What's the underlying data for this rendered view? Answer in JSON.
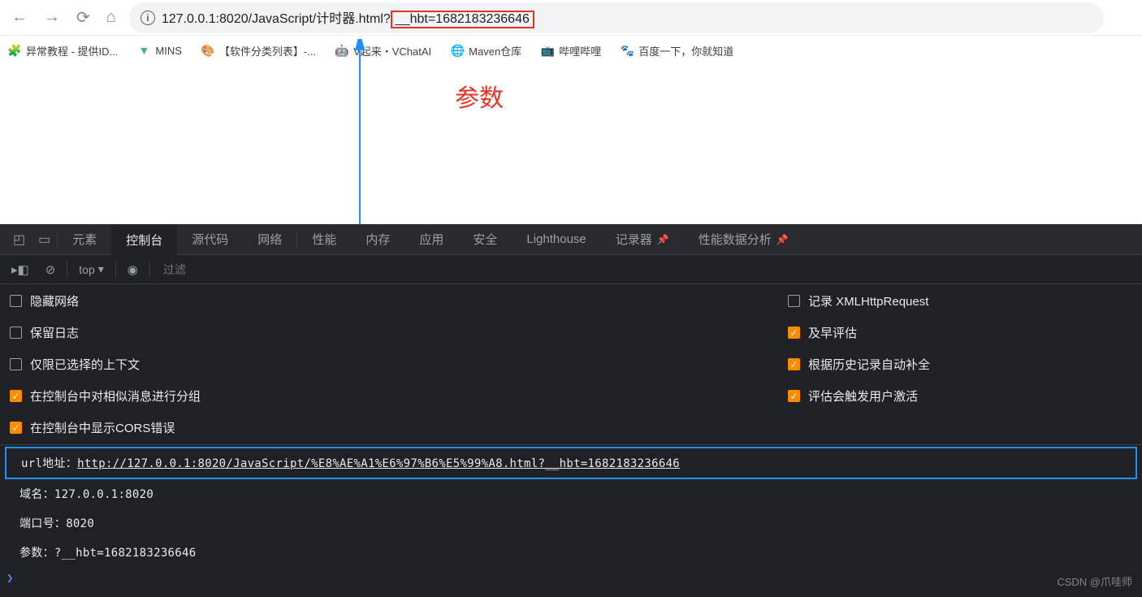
{
  "browser": {
    "url_prefix": "127.0.0.1:8020/JavaScript/计时器.html?",
    "url_highlighted": "__hbt=1682183236646"
  },
  "bookmarks": [
    {
      "label": "异常教程 - 提供ID..."
    },
    {
      "label": "MINS"
    },
    {
      "label": "【软件分类列表】-..."
    },
    {
      "label": "V起来・VChatAI"
    },
    {
      "label": "Maven仓库"
    },
    {
      "label": "哔哩哔哩"
    },
    {
      "label": "百度一下，你就知道"
    }
  ],
  "annotation": {
    "label": "参数"
  },
  "devtools": {
    "tabs": [
      "元素",
      "控制台",
      "源代码",
      "网络",
      "性能",
      "内存",
      "应用",
      "安全",
      "Lighthouse",
      "记录器",
      "性能数据分析"
    ],
    "active_tab": "控制台",
    "toolbar": {
      "top": "top",
      "filter_placeholder": "过滤"
    },
    "settings_left": [
      {
        "label": "隐藏网络",
        "checked": false
      },
      {
        "label": "保留日志",
        "checked": false
      },
      {
        "label": "仅限已选择的上下文",
        "checked": false
      },
      {
        "label": "在控制台中对相似消息进行分组",
        "checked": true
      },
      {
        "label": "在控制台中显示CORS错误",
        "checked": true
      }
    ],
    "settings_right": [
      {
        "label": "记录 XMLHttpRequest",
        "checked": false
      },
      {
        "label": "及早评估",
        "checked": true
      },
      {
        "label": "根据历史记录自动补全",
        "checked": true
      },
      {
        "label": "评估会触发用户激活",
        "checked": true
      }
    ],
    "output": {
      "line1_prefix": "url地址：",
      "line1_url": "http://127.0.0.1:8020/JavaScript/%E8%AE%A1%E6%97%B6%E5%99%A8.html?__hbt=1682183236646",
      "line2": "域名：127.0.0.1:8020",
      "line3": "端口号：8020",
      "line4": "参数：?__hbt=1682183236646"
    }
  },
  "watermark": "CSDN @爪哇师"
}
